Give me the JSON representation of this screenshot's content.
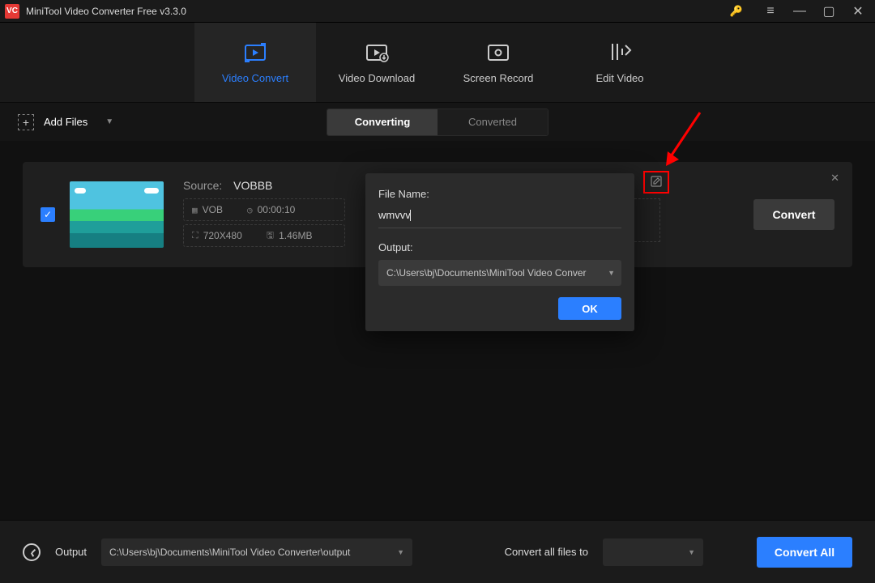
{
  "titlebar": {
    "title": "MiniTool Video Converter Free v3.3.0",
    "logo_text": "VC"
  },
  "nav": {
    "convert": "Video Convert",
    "download": "Video Download",
    "record": "Screen Record",
    "edit": "Edit Video"
  },
  "toolbar": {
    "add_files": "Add Files",
    "tab_converting": "Converting",
    "tab_converted": "Converted"
  },
  "card": {
    "source_label": "Source:",
    "source_value": "VOBBB",
    "fmt": "VOB",
    "duration": "00:00:10",
    "res": "720X480",
    "size": "1.46MB",
    "convert": "Convert"
  },
  "modal": {
    "file_name_label": "File Name:",
    "file_name_value": "wmvvv",
    "output_label": "Output:",
    "output_path": "C:\\Users\\bj\\Documents\\MiniTool Video Conver",
    "ok": "OK"
  },
  "footer": {
    "output_label": "Output",
    "output_path": "C:\\Users\\bj\\Documents\\MiniTool Video Converter\\output",
    "convert_to_label": "Convert all files to",
    "convert_all": "Convert All"
  }
}
